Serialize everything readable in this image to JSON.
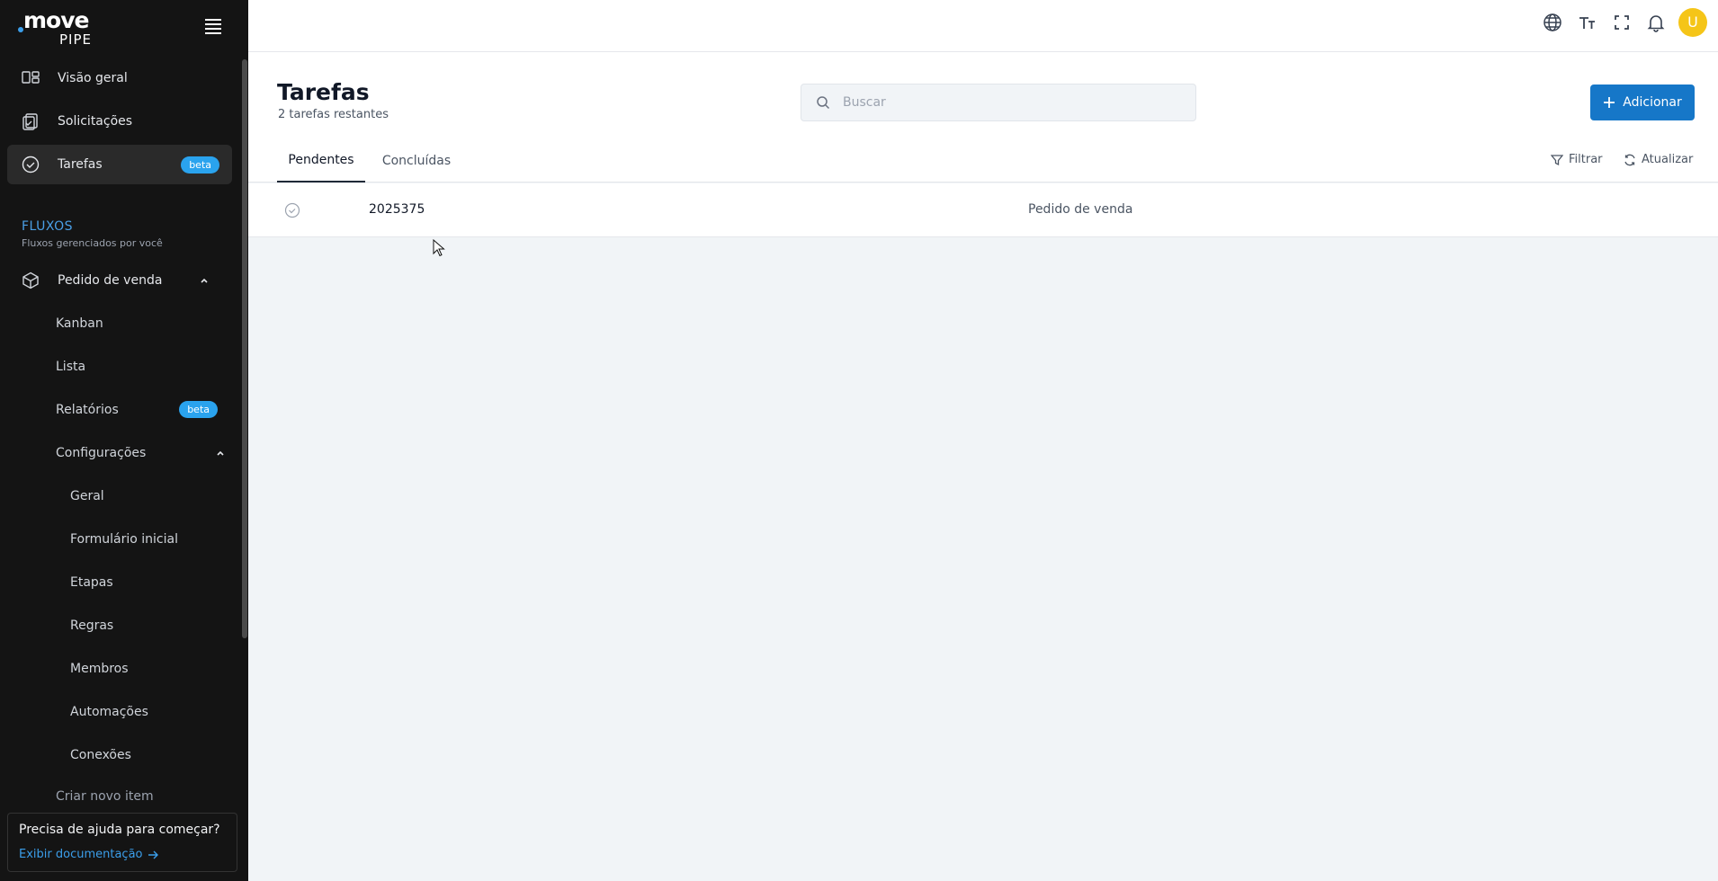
{
  "brand": {
    "line1": "move",
    "line2": "PIPE",
    "accent": "#3b9eea"
  },
  "sidebar": {
    "main_items": [
      {
        "label": "Visão geral",
        "icon": "layout-icon"
      },
      {
        "label": "Solicitações",
        "icon": "clipboard-icon"
      },
      {
        "label": "Tarefas",
        "icon": "check-circle-icon",
        "badge": "beta",
        "active": true
      }
    ],
    "section": {
      "title": "FLUXOS",
      "subtitle": "Fluxos gerenciados por você"
    },
    "flow": {
      "label": "Pedido de venda",
      "items": [
        {
          "label": "Kanban"
        },
        {
          "label": "Lista"
        },
        {
          "label": "Relatórios",
          "badge": "beta"
        }
      ],
      "config": {
        "label": "Configurações",
        "items": [
          "Geral",
          "Formulário inicial",
          "Etapas",
          "Regras",
          "Membros",
          "Automações",
          "Conexões"
        ]
      },
      "partial_item": "Criar novo item"
    },
    "help": {
      "question": "Precisa de ajuda para começar?",
      "link": "Exibir documentação"
    }
  },
  "topbar": {
    "icons": [
      "globe-icon",
      "text-size-icon",
      "fullscreen-icon",
      "bell-icon"
    ],
    "avatar_initial": "U"
  },
  "page": {
    "title": "Tarefas",
    "subtitle": "2 tarefas restantes",
    "search_placeholder": "Buscar",
    "add_label": "Adicionar",
    "tabs": [
      "Pendentes",
      "Concluídas"
    ],
    "active_tab": "Pendentes",
    "filter_label": "Filtrar",
    "refresh_label": "Atualizar"
  },
  "tasks": [
    {
      "id": "2025375",
      "flow": "Pedido de venda"
    }
  ],
  "colors": {
    "primary": "#1677c8",
    "badge": "#2aa3ee",
    "sidebar_bg": "#141414",
    "avatar": "#f5c518"
  }
}
